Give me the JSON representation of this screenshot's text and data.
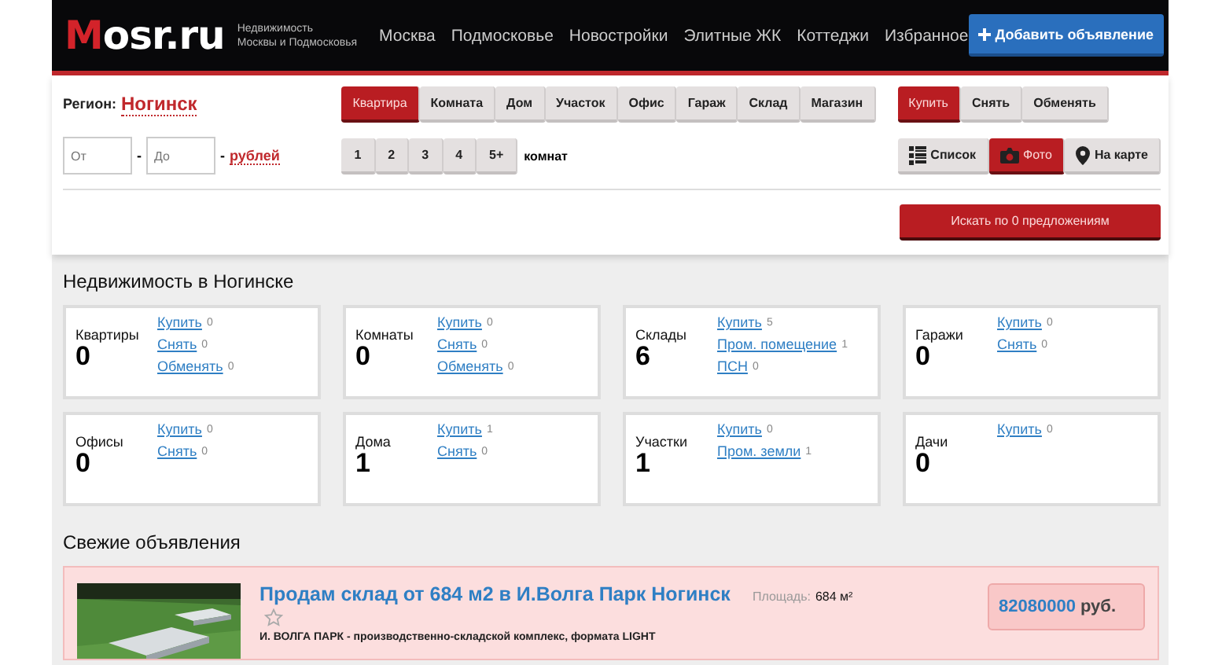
{
  "header": {
    "logo": "Mosr.ru",
    "tagline": "Недвижимость\nМосквы и Подмосковья",
    "nav": [
      "Москва",
      "Подмосковье",
      "Новостройки",
      "Элитные ЖК",
      "Коттеджи",
      "Избранное"
    ],
    "add_button": "Добавить объявление"
  },
  "filters": {
    "region_label": "Регион:",
    "region": "Ногинск",
    "types": [
      {
        "label": "Квартира",
        "selected": true
      },
      {
        "label": "Комната",
        "selected": false
      },
      {
        "label": "Дом",
        "selected": false
      },
      {
        "label": "Участок",
        "selected": false
      },
      {
        "label": "Офис",
        "selected": false
      },
      {
        "label": "Гараж",
        "selected": false
      },
      {
        "label": "Склад",
        "selected": false
      },
      {
        "label": "Магазин",
        "selected": false
      }
    ],
    "deals": [
      {
        "label": "Купить",
        "selected": true
      },
      {
        "label": "Снять",
        "selected": false
      },
      {
        "label": "Обменять",
        "selected": false
      }
    ],
    "price_from": {
      "placeholder": "От"
    },
    "separator": "-",
    "price_to": {
      "placeholder": "До"
    },
    "currency_separator": "-",
    "currency": "рублей",
    "rooms": [
      {
        "label": "1",
        "selected": false
      },
      {
        "label": "2",
        "selected": false
      },
      {
        "label": "3",
        "selected": false
      },
      {
        "label": "4",
        "selected": false
      },
      {
        "label": "5+",
        "selected": false
      }
    ],
    "rooms_label": "комнат",
    "views": [
      {
        "kind": "list",
        "label": "Список",
        "selected": false
      },
      {
        "label": "Фото",
        "selected": true
      },
      {
        "kind": "map",
        "label": "На карте",
        "selected": false
      }
    ],
    "search_button": "Искать по 0 предложениям"
  },
  "categories_title": "Недвижимость в Ногинске",
  "categories": [
    {
      "title": "Квартиры",
      "count": "0",
      "links": [
        {
          "label": "Купить",
          "count": "0"
        },
        {
          "label": "Снять",
          "count": "0"
        },
        {
          "label": "Обменять",
          "count": "0"
        }
      ]
    },
    {
      "title": "Комнаты",
      "count": "0",
      "links": [
        {
          "label": "Купить",
          "count": "0"
        },
        {
          "label": "Снять",
          "count": "0"
        },
        {
          "label": "Обменять",
          "count": "0"
        }
      ]
    },
    {
      "title": "Склады",
      "count": "6",
      "links": [
        {
          "label": "Купить",
          "count": "5"
        },
        {
          "label": "Пром. помещение",
          "count": "1"
        },
        {
          "label": "ПСН",
          "count": "0"
        }
      ]
    },
    {
      "title": "Гаражи",
      "count": "0",
      "links": [
        {
          "label": "Купить",
          "count": "0"
        },
        {
          "label": "Снять",
          "count": "0"
        }
      ]
    },
    {
      "title": "Офисы",
      "count": "0",
      "links": [
        {
          "label": "Купить",
          "count": "0"
        },
        {
          "label": "Снять",
          "count": "0"
        }
      ]
    },
    {
      "title": "Дома",
      "count": "1",
      "links": [
        {
          "label": "Купить",
          "count": "1"
        },
        {
          "label": "Снять",
          "count": "0"
        }
      ]
    },
    {
      "title": "Участки",
      "count": "1",
      "links": [
        {
          "label": "Купить",
          "count": "0"
        },
        {
          "label": "Пром. земли",
          "count": "1"
        }
      ]
    },
    {
      "title": "Дачи",
      "count": "0",
      "links": [
        {
          "label": "Купить",
          "count": "0"
        }
      ]
    }
  ],
  "listings_title": "Свежие объявления",
  "listings": [
    {
      "title": "Продам склад от 684 м2 в И.Волга Парк Ногинск",
      "favorite": false,
      "area_label": "Площадь:",
      "area": "684 м²",
      "description": "И. ВОЛГА ПАРК - производственно-складской комплекс, формата LIGHT",
      "price": "82080000",
      "currency": "руб."
    }
  ]
}
